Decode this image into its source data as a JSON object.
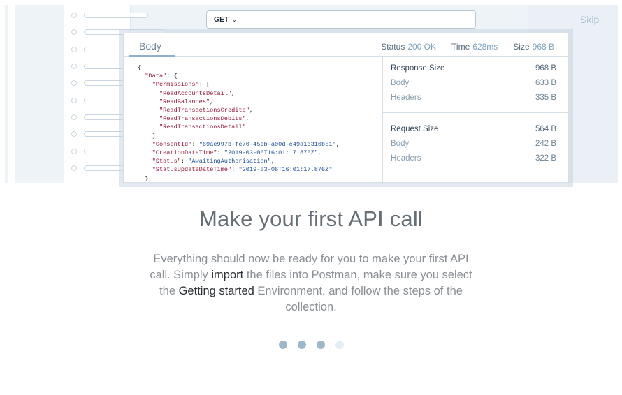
{
  "skip_label": "Skip",
  "request": {
    "method": "GET"
  },
  "response": {
    "tab_label": "Body",
    "status_label": "Status",
    "status_value": "200 OK",
    "time_label": "Time",
    "time_value": "628ms",
    "size_label": "Size",
    "size_value": "968 B",
    "code_lines": [
      [
        {
          "t": "p",
          "v": "{"
        }
      ],
      [
        {
          "t": "p",
          "v": "  "
        },
        {
          "t": "k",
          "v": "\"Data\""
        },
        {
          "t": "p",
          "v": ": {"
        }
      ],
      [
        {
          "t": "p",
          "v": "    "
        },
        {
          "t": "k",
          "v": "\"Permissions\""
        },
        {
          "t": "p",
          "v": ": ["
        }
      ],
      [
        {
          "t": "p",
          "v": "      "
        },
        {
          "t": "k",
          "v": "\"ReadAccountsDetail\""
        },
        {
          "t": "p",
          "v": ","
        }
      ],
      [
        {
          "t": "p",
          "v": "      "
        },
        {
          "t": "k",
          "v": "\"ReadBalances\""
        },
        {
          "t": "p",
          "v": ","
        }
      ],
      [
        {
          "t": "p",
          "v": "      "
        },
        {
          "t": "k",
          "v": "\"ReadTransactionsCredits\""
        },
        {
          "t": "p",
          "v": ","
        }
      ],
      [
        {
          "t": "p",
          "v": "      "
        },
        {
          "t": "k",
          "v": "\"ReadTransactionsDebits\""
        },
        {
          "t": "p",
          "v": ","
        }
      ],
      [
        {
          "t": "p",
          "v": "      "
        },
        {
          "t": "k",
          "v": "\"ReadTransactionsDetail\""
        }
      ],
      [
        {
          "t": "p",
          "v": "    ],"
        }
      ],
      [
        {
          "t": "p",
          "v": "    "
        },
        {
          "t": "k",
          "v": "\"ConsentId\""
        },
        {
          "t": "p",
          "v": ": "
        },
        {
          "t": "s",
          "v": "\"69ae997b-fe70-45eb-a00d-c49a1d310b51\""
        },
        {
          "t": "p",
          "v": ","
        }
      ],
      [
        {
          "t": "p",
          "v": "    "
        },
        {
          "t": "k",
          "v": "\"CreationDateTime\""
        },
        {
          "t": "p",
          "v": ": "
        },
        {
          "t": "s",
          "v": "\"2019-03-06T16:01:17.876Z\""
        },
        {
          "t": "p",
          "v": ","
        }
      ],
      [
        {
          "t": "p",
          "v": "    "
        },
        {
          "t": "k",
          "v": "\"Status\""
        },
        {
          "t": "p",
          "v": ": "
        },
        {
          "t": "s",
          "v": "\"AwaitingAuthorisation\""
        },
        {
          "t": "p",
          "v": ","
        }
      ],
      [
        {
          "t": "p",
          "v": "    "
        },
        {
          "t": "k",
          "v": "\"StatusUpdateDateTime\""
        },
        {
          "t": "p",
          "v": ": "
        },
        {
          "t": "s",
          "v": "\"2019-03-06T16:01:17.876Z\""
        }
      ],
      [
        {
          "t": "p",
          "v": "  },"
        }
      ]
    ],
    "response_size": {
      "label": "Response Size",
      "value": "968 B",
      "body_label": "Body",
      "body_value": "633 B",
      "headers_label": "Headers",
      "headers_value": "335 B"
    },
    "request_size": {
      "label": "Request Size",
      "value": "564 B",
      "body_label": "Body",
      "body_value": "242 B",
      "headers_label": "Headers",
      "headers_value": "322 B"
    }
  },
  "heading": "Make your first API call",
  "description": {
    "part1": "Everything should now be ready for you to make your first API call. Simply ",
    "link1": "import",
    "part2": " the files into Postman, make sure you select the ",
    "link2": "Getting started",
    "part3": " Environment, and follow the steps of the collection."
  },
  "pager": {
    "total": 4,
    "active_count": 3
  }
}
